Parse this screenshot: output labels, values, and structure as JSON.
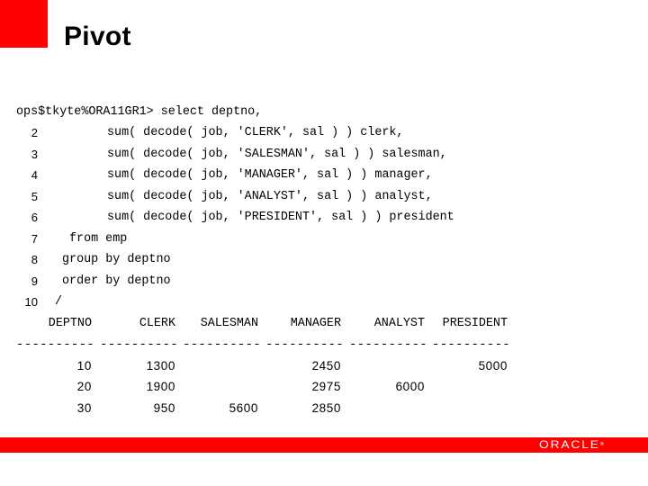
{
  "slide": {
    "title": "Pivot",
    "brand_color": "#ff0000",
    "logo_text": "ORACLE",
    "logo_mark": "®"
  },
  "query": {
    "prompt_line": "ops$tkyte%ORA11GR1> select deptno,",
    "lines": [
      {
        "num": "2",
        "text": "sum( decode( job, 'CLERK', sal ) ) clerk,"
      },
      {
        "num": "3",
        "text": "sum( decode( job, 'SALESMAN', sal ) ) salesman,"
      },
      {
        "num": "4",
        "text": "sum( decode( job, 'MANAGER', sal ) ) manager,"
      },
      {
        "num": "5",
        "text": "sum( decode( job, 'ANALYST', sal ) ) analyst,"
      },
      {
        "num": "6",
        "text": "sum( decode( job, 'PRESIDENT', sal ) ) president"
      },
      {
        "num": "7",
        "text": "from emp"
      },
      {
        "num": "8",
        "text": "group by deptno"
      },
      {
        "num": "9",
        "text": "order by deptno"
      },
      {
        "num": "10",
        "text": "/"
      }
    ]
  },
  "result": {
    "columns": [
      "DEPTNO",
      "CLERK",
      "SALESMAN",
      "MANAGER",
      "ANALYST",
      "PRESIDENT"
    ],
    "separator": "----------",
    "rows": [
      {
        "DEPTNO": "10",
        "CLERK": "1300",
        "SALESMAN": "",
        "MANAGER": "2450",
        "ANALYST": "",
        "PRESIDENT": "5000"
      },
      {
        "DEPTNO": "20",
        "CLERK": "1900",
        "SALESMAN": "",
        "MANAGER": "2975",
        "ANALYST": "6000",
        "PRESIDENT": ""
      },
      {
        "DEPTNO": "30",
        "CLERK": "950",
        "SALESMAN": "5600",
        "MANAGER": "2850",
        "ANALYST": "",
        "PRESIDENT": ""
      }
    ]
  }
}
